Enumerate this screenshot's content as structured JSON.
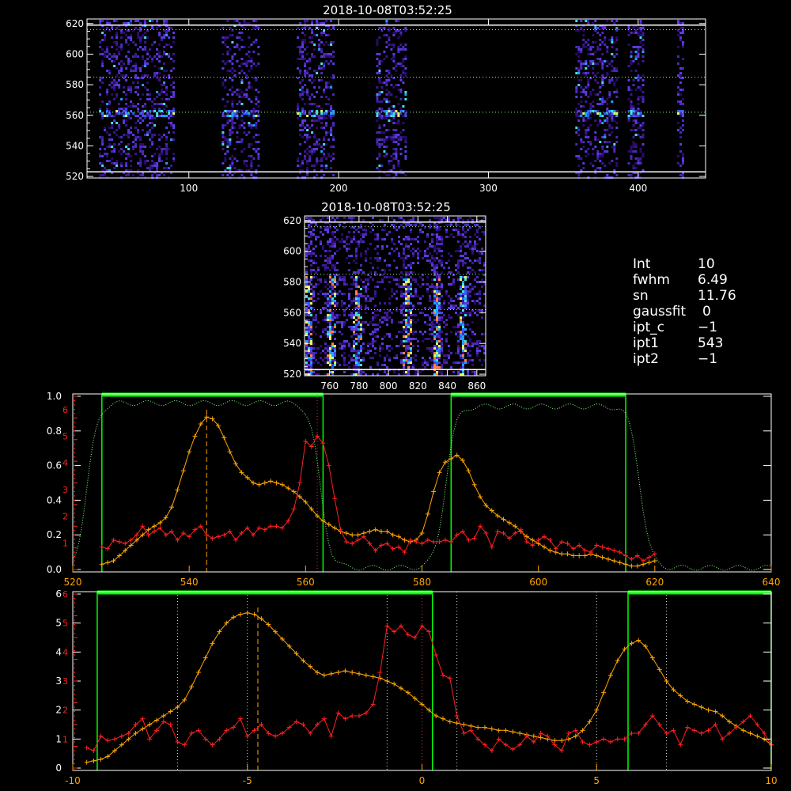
{
  "titles": {
    "top_title": "2018-10-08T03:52:25",
    "mid_title": "2018-10-08T03:52:25"
  },
  "info_panel": [
    {
      "key": "Int",
      "value": "10"
    },
    {
      "key": "fwhm",
      "value": "6.49"
    },
    {
      "key": "sn",
      "value": "11.76"
    },
    {
      "key": "gaussfit",
      "value": "0"
    },
    {
      "key": "ipt_c",
      "value": "−1"
    },
    {
      "key": "ipt1",
      "value": "543"
    },
    {
      "key": "ipt2",
      "value": "−1"
    }
  ],
  "colors": {
    "orange": "#ffa500",
    "red": "#ff2020",
    "green": "#00ff00",
    "light_green": "#88ff88",
    "dotted_gray": "#cccccc"
  },
  "chart_data": [
    {
      "type": "heatmap",
      "id": "top",
      "xlim": [
        32,
        445
      ],
      "ylim": [
        519,
        623
      ],
      "x_ticks": [
        100,
        200,
        300,
        400
      ],
      "y_ticks": [
        520,
        540,
        560,
        580,
        600,
        620
      ],
      "hlines_solid": [
        523,
        619
      ],
      "hlines_dotted": [
        562,
        585,
        616
      ],
      "bright_row": 562,
      "bands": [
        [
          40,
          90
        ],
        [
          122,
          147
        ],
        [
          172,
          197
        ],
        [
          225,
          245
        ],
        [
          358,
          385
        ],
        [
          393,
          404
        ],
        [
          426,
          430
        ]
      ]
    },
    {
      "type": "heatmap",
      "id": "mid",
      "xlim": [
        743,
        866
      ],
      "ylim": [
        519,
        623
      ],
      "x_ticks": [
        760,
        780,
        800,
        820,
        840,
        860
      ],
      "y_ticks": [
        520,
        540,
        560,
        580,
        600,
        620
      ],
      "hlines_solid": [
        523,
        619
      ],
      "hlines_dotted": [
        562,
        585,
        616
      ],
      "bright_columns": [
        745,
        760,
        778,
        812,
        832,
        850
      ]
    },
    {
      "type": "line",
      "id": "spectrum",
      "xlim": [
        520,
        640
      ],
      "x_ticks": [
        520,
        540,
        560,
        580,
        600,
        620,
        640
      ],
      "left_ticks": [
        "0.0",
        "0.2",
        "0.4",
        "0.6",
        "0.8",
        "1.0"
      ],
      "left_ticks_red": [
        "1",
        "2",
        "3",
        "4",
        "5",
        "6"
      ],
      "green_windows": [
        [
          525,
          563
        ],
        [
          585,
          615
        ]
      ],
      "vline_dashed": 543,
      "vline_dotted_red": 562,
      "series": [
        {
          "role": "orange",
          "x": [
            525,
            526,
            527,
            528,
            529,
            530,
            531,
            532,
            533,
            534,
            535,
            536,
            537,
            538,
            539,
            540,
            541,
            542,
            543,
            544,
            545,
            546,
            547,
            548,
            549,
            550,
            551,
            552,
            553,
            554,
            555,
            556,
            557,
            558,
            559,
            560,
            561,
            562,
            563,
            564,
            565,
            566,
            567,
            568,
            569,
            570,
            571,
            572,
            573,
            574,
            575,
            576,
            577,
            578,
            579,
            580,
            581,
            582,
            583,
            584,
            585,
            586,
            587,
            588,
            589,
            590,
            591,
            592,
            593,
            594,
            595,
            596,
            597,
            598,
            599,
            600,
            601,
            602,
            603,
            604,
            605,
            606,
            607,
            608,
            609,
            610,
            611,
            612,
            613,
            614,
            615,
            616,
            617,
            618,
            619,
            620
          ],
          "y": [
            0.03,
            0.04,
            0.05,
            0.08,
            0.11,
            0.14,
            0.17,
            0.2,
            0.23,
            0.25,
            0.27,
            0.3,
            0.36,
            0.46,
            0.57,
            0.68,
            0.77,
            0.84,
            0.88,
            0.87,
            0.83,
            0.76,
            0.68,
            0.61,
            0.56,
            0.53,
            0.5,
            0.49,
            0.5,
            0.51,
            0.5,
            0.49,
            0.47,
            0.45,
            0.42,
            0.39,
            0.35,
            0.31,
            0.28,
            0.26,
            0.24,
            0.22,
            0.21,
            0.2,
            0.2,
            0.21,
            0.22,
            0.23,
            0.22,
            0.22,
            0.2,
            0.19,
            0.17,
            0.16,
            0.17,
            0.21,
            0.32,
            0.45,
            0.56,
            0.62,
            0.64,
            0.66,
            0.63,
            0.57,
            0.49,
            0.42,
            0.37,
            0.34,
            0.31,
            0.29,
            0.27,
            0.25,
            0.22,
            0.19,
            0.17,
            0.15,
            0.13,
            0.11,
            0.1,
            0.09,
            0.09,
            0.08,
            0.08,
            0.08,
            0.09,
            0.08,
            0.07,
            0.06,
            0.05,
            0.04,
            0.03,
            0.02,
            0.02,
            0.03,
            0.04,
            0.05
          ]
        },
        {
          "role": "red",
          "x": [
            525,
            526,
            527,
            528,
            529,
            530,
            531,
            532,
            533,
            534,
            535,
            536,
            537,
            538,
            539,
            540,
            541,
            542,
            543,
            544,
            545,
            546,
            547,
            548,
            549,
            550,
            551,
            552,
            553,
            554,
            555,
            556,
            557,
            558,
            559,
            560,
            561,
            562,
            563,
            564,
            565,
            566,
            567,
            568,
            569,
            570,
            571,
            572,
            573,
            574,
            575,
            576,
            577,
            578,
            579,
            580,
            581,
            582,
            583,
            584,
            585,
            586,
            587,
            588,
            589,
            590,
            591,
            592,
            593,
            594,
            595,
            596,
            597,
            598,
            599,
            600,
            601,
            602,
            603,
            604,
            605,
            606,
            607,
            608,
            609,
            610,
            611,
            612,
            613,
            614,
            615,
            616,
            617,
            618,
            619,
            620
          ],
          "y": [
            0.13,
            0.12,
            0.17,
            0.16,
            0.15,
            0.17,
            0.2,
            0.25,
            0.2,
            0.22,
            0.24,
            0.2,
            0.22,
            0.17,
            0.21,
            0.19,
            0.23,
            0.25,
            0.2,
            0.18,
            0.19,
            0.2,
            0.22,
            0.17,
            0.21,
            0.24,
            0.2,
            0.24,
            0.23,
            0.25,
            0.25,
            0.24,
            0.28,
            0.35,
            0.5,
            0.74,
            0.71,
            0.77,
            0.73,
            0.6,
            0.41,
            0.23,
            0.16,
            0.15,
            0.17,
            0.19,
            0.15,
            0.11,
            0.14,
            0.15,
            0.12,
            0.13,
            0.1,
            0.17,
            0.16,
            0.15,
            0.17,
            0.16,
            0.16,
            0.17,
            0.16,
            0.2,
            0.22,
            0.17,
            0.18,
            0.25,
            0.21,
            0.13,
            0.22,
            0.21,
            0.18,
            0.21,
            0.23,
            0.16,
            0.14,
            0.17,
            0.19,
            0.17,
            0.12,
            0.16,
            0.15,
            0.12,
            0.14,
            0.11,
            0.1,
            0.14,
            0.13,
            0.12,
            0.11,
            0.1,
            0.08,
            0.06,
            0.08,
            0.05,
            0.07,
            0.09
          ]
        }
      ]
    },
    {
      "type": "line",
      "id": "velocity",
      "xlim": [
        -10,
        10
      ],
      "x_ticks": [
        -10,
        -5,
        0,
        5,
        10
      ],
      "left_ticks": [
        "0",
        "1",
        "2",
        "3",
        "4",
        "5",
        "6"
      ],
      "left_ticks_red": [
        "1",
        "2",
        "3",
        "4",
        "5",
        "6"
      ],
      "green_windows": [
        [
          -9.3,
          0.3
        ],
        [
          5.9,
          10
        ]
      ],
      "vline_dashed": -4.7,
      "vlines_dotted": [
        -7,
        -5,
        -1,
        1,
        5,
        7
      ],
      "vline_dotted_red": 0,
      "series": [
        {
          "role": "orange",
          "x": [
            -9.6,
            -9.4,
            -9.2,
            -9.0,
            -8.8,
            -8.6,
            -8.4,
            -8.2,
            -8.0,
            -7.8,
            -7.6,
            -7.4,
            -7.2,
            -7.0,
            -6.8,
            -6.6,
            -6.4,
            -6.2,
            -6.0,
            -5.8,
            -5.6,
            -5.4,
            -5.2,
            -5.0,
            -4.8,
            -4.6,
            -4.4,
            -4.2,
            -4.0,
            -3.8,
            -3.6,
            -3.4,
            -3.2,
            -3.0,
            -2.8,
            -2.6,
            -2.4,
            -2.2,
            -2.0,
            -1.8,
            -1.6,
            -1.4,
            -1.2,
            -1.0,
            -0.8,
            -0.6,
            -0.4,
            -0.2,
            0.0,
            0.2,
            0.4,
            0.6,
            0.8,
            1.0,
            1.2,
            1.4,
            1.6,
            1.8,
            2.0,
            2.2,
            2.4,
            2.6,
            2.8,
            3.0,
            3.2,
            3.4,
            3.6,
            3.8,
            4.0,
            4.2,
            4.4,
            4.6,
            4.8,
            5.0,
            5.2,
            5.4,
            5.6,
            5.8,
            6.0,
            6.2,
            6.4,
            6.6,
            6.8,
            7.0,
            7.2,
            7.4,
            7.6,
            7.8,
            8.0,
            8.2,
            8.4,
            8.6,
            8.8,
            9.0,
            9.2,
            9.4,
            9.6,
            9.8,
            10.0
          ],
          "y": [
            0.2,
            0.25,
            0.3,
            0.4,
            0.6,
            0.8,
            1.0,
            1.2,
            1.35,
            1.5,
            1.65,
            1.8,
            1.95,
            2.1,
            2.35,
            2.8,
            3.3,
            3.8,
            4.3,
            4.7,
            5.0,
            5.2,
            5.3,
            5.35,
            5.3,
            5.15,
            4.95,
            4.7,
            4.45,
            4.2,
            3.95,
            3.7,
            3.5,
            3.3,
            3.2,
            3.25,
            3.3,
            3.35,
            3.3,
            3.25,
            3.2,
            3.15,
            3.1,
            3.0,
            2.9,
            2.75,
            2.6,
            2.4,
            2.2,
            2.0,
            1.8,
            1.7,
            1.6,
            1.55,
            1.5,
            1.45,
            1.4,
            1.4,
            1.35,
            1.3,
            1.3,
            1.25,
            1.2,
            1.15,
            1.1,
            1.05,
            1.0,
            0.95,
            0.95,
            1.0,
            1.1,
            1.3,
            1.6,
            2.0,
            2.6,
            3.2,
            3.7,
            4.1,
            4.3,
            4.4,
            4.2,
            3.8,
            3.4,
            3.0,
            2.7,
            2.5,
            2.3,
            2.2,
            2.1,
            2.0,
            1.95,
            1.8,
            1.6,
            1.45,
            1.3,
            1.2,
            1.1,
            1.0,
            0.8
          ]
        },
        {
          "role": "red",
          "x": [
            -9.6,
            -9.4,
            -9.2,
            -9.0,
            -8.8,
            -8.6,
            -8.4,
            -8.2,
            -8.0,
            -7.8,
            -7.6,
            -7.4,
            -7.2,
            -7.0,
            -6.8,
            -6.6,
            -6.4,
            -6.2,
            -6.0,
            -5.8,
            -5.6,
            -5.4,
            -5.2,
            -5.0,
            -4.8,
            -4.6,
            -4.4,
            -4.2,
            -4.0,
            -3.8,
            -3.6,
            -3.4,
            -3.2,
            -3.0,
            -2.8,
            -2.6,
            -2.4,
            -2.2,
            -2.0,
            -1.8,
            -1.6,
            -1.4,
            -1.2,
            -1.0,
            -0.8,
            -0.6,
            -0.4,
            -0.2,
            0.0,
            0.2,
            0.4,
            0.6,
            0.8,
            1.0,
            1.2,
            1.4,
            1.6,
            1.8,
            2.0,
            2.2,
            2.4,
            2.6,
            2.8,
            3.0,
            3.2,
            3.4,
            3.6,
            3.8,
            4.0,
            4.2,
            4.4,
            4.6,
            4.8,
            5.0,
            5.2,
            5.4,
            5.6,
            5.8,
            6.0,
            6.2,
            6.4,
            6.6,
            6.8,
            7.0,
            7.2,
            7.4,
            7.6,
            7.8,
            8.0,
            8.2,
            8.4,
            8.6,
            8.8,
            9.0,
            9.2,
            9.4,
            9.6,
            9.8,
            10.0
          ],
          "y": [
            0.7,
            0.6,
            1.1,
            0.95,
            1.0,
            1.1,
            1.2,
            1.5,
            1.7,
            1.0,
            1.3,
            1.6,
            1.5,
            0.9,
            0.8,
            1.2,
            1.3,
            1.0,
            0.8,
            1.0,
            1.3,
            1.4,
            1.7,
            1.1,
            1.3,
            1.5,
            1.2,
            1.1,
            1.2,
            1.4,
            1.6,
            1.5,
            1.2,
            1.5,
            1.7,
            1.1,
            1.9,
            1.7,
            1.8,
            1.8,
            1.9,
            2.2,
            3.3,
            4.9,
            4.7,
            4.9,
            4.6,
            4.5,
            4.9,
            4.7,
            3.9,
            3.2,
            3.1,
            1.8,
            1.2,
            1.3,
            1.0,
            0.8,
            0.6,
            1.0,
            0.8,
            0.65,
            0.8,
            1.1,
            0.9,
            1.2,
            1.1,
            0.8,
            0.6,
            1.2,
            1.3,
            0.9,
            0.8,
            0.9,
            1.0,
            0.9,
            1.0,
            1.0,
            1.2,
            1.2,
            1.5,
            1.8,
            1.5,
            1.2,
            1.3,
            0.8,
            1.4,
            1.3,
            1.2,
            1.3,
            1.5,
            1.0,
            1.2,
            1.4,
            1.6,
            1.8,
            1.5,
            1.2,
            0.8
          ]
        }
      ]
    }
  ]
}
